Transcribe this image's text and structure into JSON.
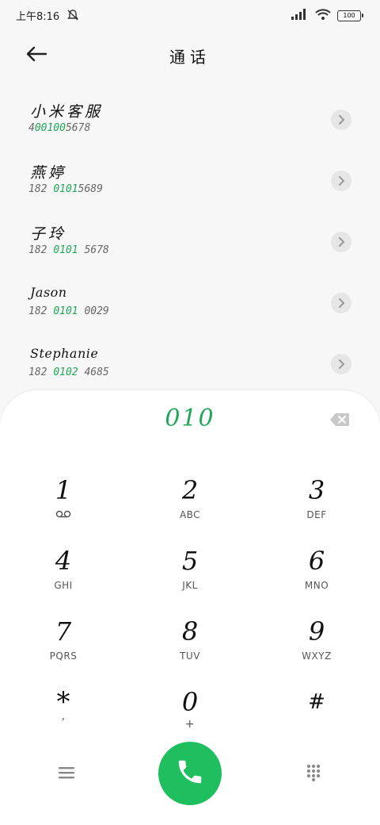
{
  "status_bar": {
    "time": "上午8:16",
    "battery": "100"
  },
  "header": {
    "title": "通话"
  },
  "contacts": [
    {
      "name": "小米客服",
      "number_pre": "4",
      "number_hl": "00100",
      "number_post": "5678"
    },
    {
      "name": "燕婷",
      "number_pre": "182 ",
      "number_hl": "0101",
      "number_post": "5689"
    },
    {
      "name": "子玲",
      "number_pre": "182 ",
      "number_hl": "0101",
      "number_post": " 5678"
    },
    {
      "name": "Jason",
      "number_pre": "182 ",
      "number_hl": "0101",
      "number_post": " 0029"
    },
    {
      "name": "Stephanie",
      "number_pre": "182 ",
      "number_hl": "0102",
      "number_post": " 4685"
    }
  ],
  "dialer": {
    "input": "010",
    "keys": [
      {
        "digit": "1",
        "sub": ""
      },
      {
        "digit": "2",
        "sub": "ABC"
      },
      {
        "digit": "3",
        "sub": "DEF"
      },
      {
        "digit": "4",
        "sub": "GHI"
      },
      {
        "digit": "5",
        "sub": "JKL"
      },
      {
        "digit": "6",
        "sub": "MNO"
      },
      {
        "digit": "7",
        "sub": "PQRS"
      },
      {
        "digit": "8",
        "sub": "TUV"
      },
      {
        "digit": "9",
        "sub": "WXYZ"
      },
      {
        "digit": "*",
        "sub": ","
      },
      {
        "digit": "0",
        "sub": "+"
      },
      {
        "digit": "#",
        "sub": ""
      }
    ]
  },
  "icons": {
    "back": "arrow-left-icon",
    "chevron": "chevron-right-icon",
    "backspace": "backspace-icon",
    "voicemail": "voicemail-icon",
    "menu": "menu-icon",
    "call": "phone-icon",
    "dialpad": "dialpad-icon"
  },
  "colors": {
    "accent": "#22a75a",
    "call_button": "#1fbf5f"
  }
}
